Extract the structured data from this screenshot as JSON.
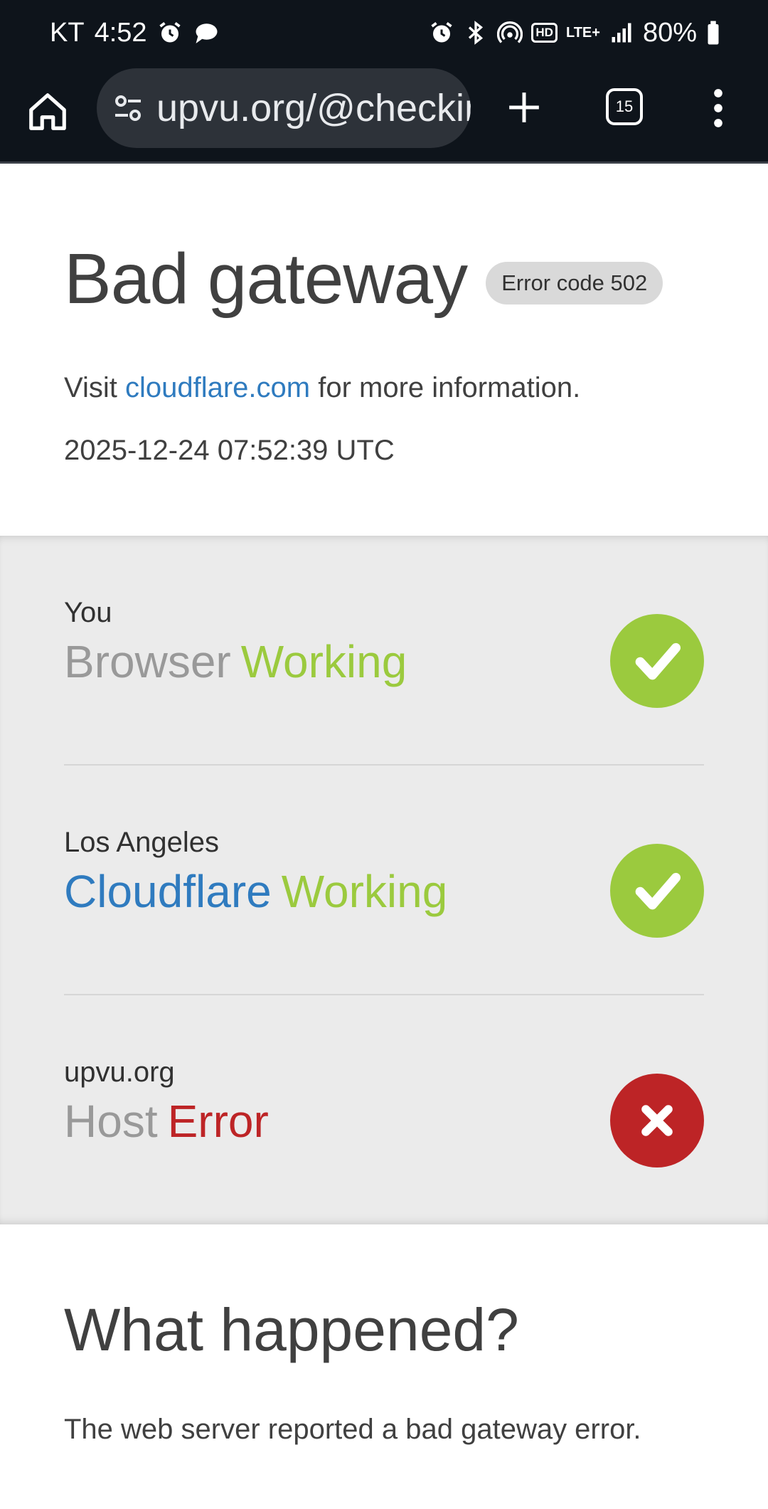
{
  "status_bar": {
    "carrier": "KT",
    "time": "4:52",
    "hd_label": "HD",
    "network": "LTE+",
    "battery": "80%"
  },
  "browser": {
    "url": "upvu.org/@checkingbot",
    "tab_count": "15"
  },
  "page": {
    "title": "Bad gateway",
    "error_badge": "Error code 502",
    "visit_prefix": "Visit ",
    "visit_link": "cloudflare.com",
    "visit_suffix": " for more information.",
    "timestamp": "2025-12-24 07:52:39 UTC"
  },
  "status_items": [
    {
      "location": "You",
      "name": "Browser",
      "status": "Working"
    },
    {
      "location": "Los Angeles",
      "name": "Cloudflare",
      "status": "Working"
    },
    {
      "location": "upvu.org",
      "name": "Host",
      "status": "Error"
    }
  ],
  "what_happened": {
    "title": "What happened?",
    "body": "The web server reported a bad gateway error."
  },
  "colors": {
    "working": "#9bca3e",
    "error": "#bd2426",
    "link": "#2f7bbf"
  }
}
